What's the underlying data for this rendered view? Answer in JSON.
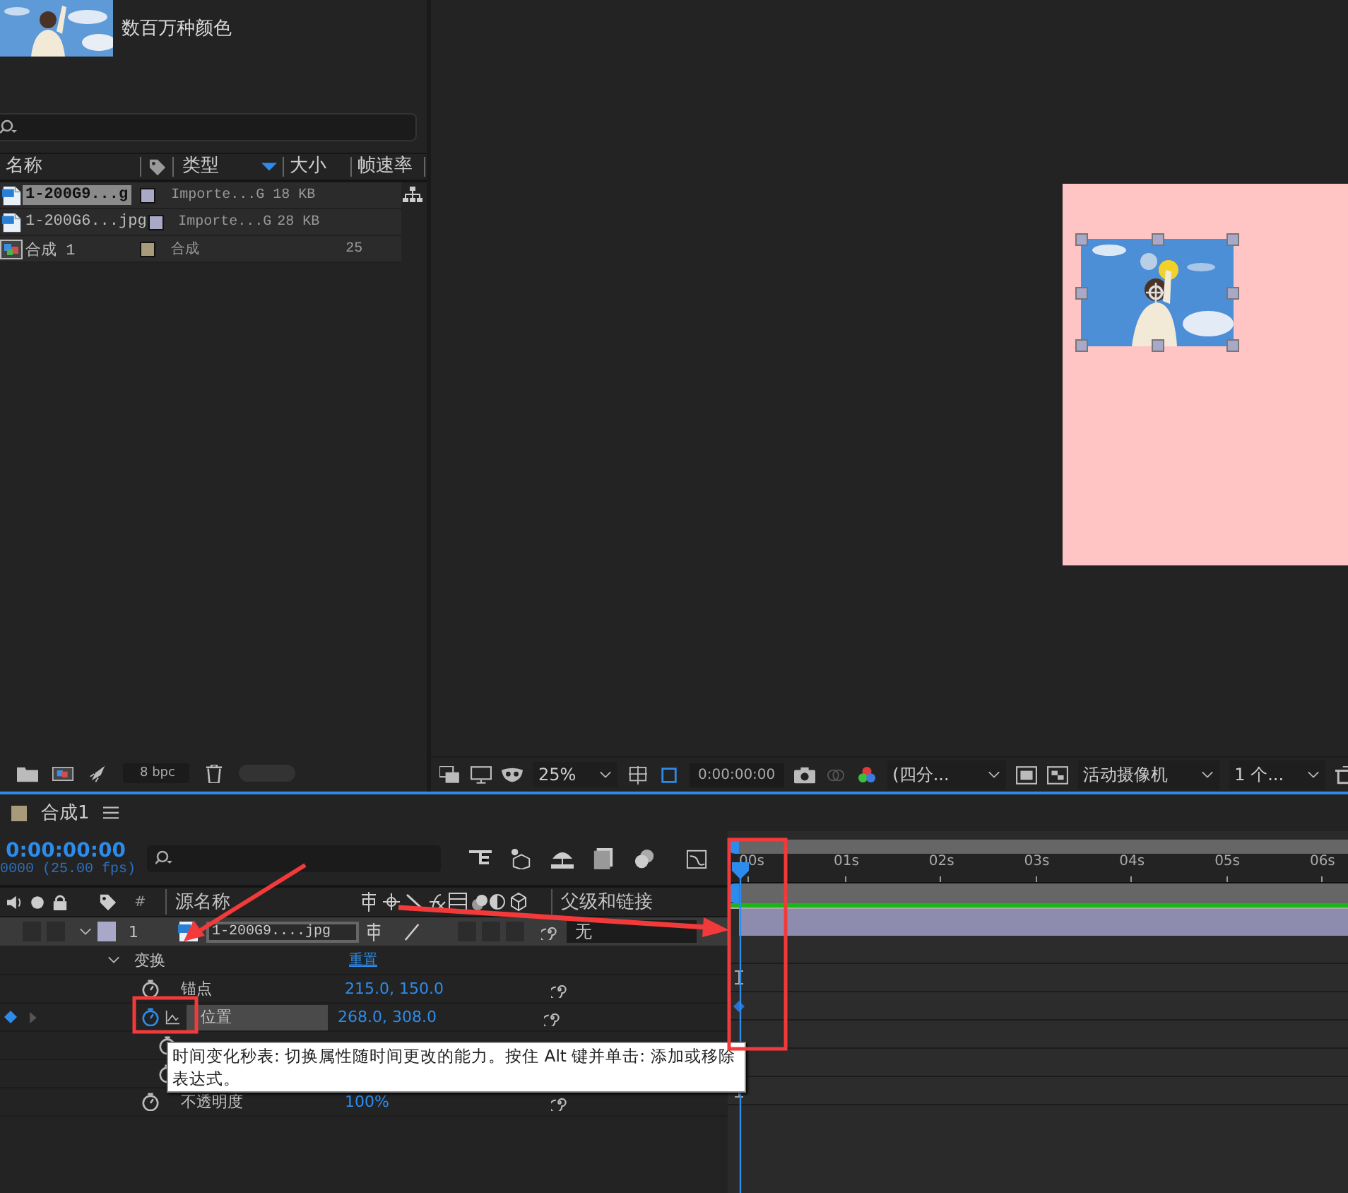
{
  "project": {
    "preview_caption": "数百万种颜色",
    "columns": [
      "名称",
      "类型",
      "大小",
      "帧速率"
    ],
    "items": [
      {
        "kind": "footage",
        "name": "1-200G9...g",
        "color": "#aaa8c8",
        "type": "Importe...G",
        "size": "18 KB",
        "selected": true
      },
      {
        "kind": "footage",
        "name": "1-200G6...jpg",
        "color": "#aaa8c8",
        "type": "Importe...G",
        "size": "28 KB",
        "selected": false
      },
      {
        "kind": "comp",
        "name": "合成 1",
        "color": "#a99a7a",
        "type": "合成",
        "fps": "25",
        "selected": false
      }
    ],
    "bit_depth": "8 bpc"
  },
  "viewer": {
    "zoom": "25%",
    "timecode": "0:00:00:00",
    "layout": "(四分...",
    "camera": "活动摄像机",
    "views": "1 个..."
  },
  "timeline": {
    "tabs": [
      {
        "name": "合成1",
        "color": "#a99a7a"
      }
    ],
    "navigator": {
      "level": 1
    },
    "current_time": "0:00:00:00",
    "frame_info": "0000 (25.00 fps)",
    "columns": {
      "number": "#",
      "source_name": "源名称",
      "parent": "父级和链接"
    },
    "ruler": [
      "00s",
      "01s",
      "02s",
      "03s",
      "04s",
      "05s",
      "06s"
    ],
    "layers": [
      {
        "number": "1",
        "name": "1-200G9....jpg",
        "color": "#aaa8c8",
        "expanded": true,
        "parent": "无",
        "group": "变换",
        "reset": "重置",
        "properties": [
          {
            "kind": "visible",
            "name": "锚点",
            "value": "215.0, 150.0",
            "keyframed": false,
            "selected": false
          },
          {
            "kind": "visible",
            "name": "位置",
            "value": "268.0, 308.0",
            "keyframed": true,
            "selected": true
          },
          {
            "kind": "covered"
          },
          {
            "kind": "covered"
          },
          {
            "kind": "visible",
            "name": "不透明度",
            "value": "100%",
            "keyframed": false,
            "selected": false
          }
        ]
      }
    ]
  },
  "tooltip": "时间变化秒表: 切换属性随时间更改的能力。按住 Alt 键并单击: 添加或移除表达式。"
}
